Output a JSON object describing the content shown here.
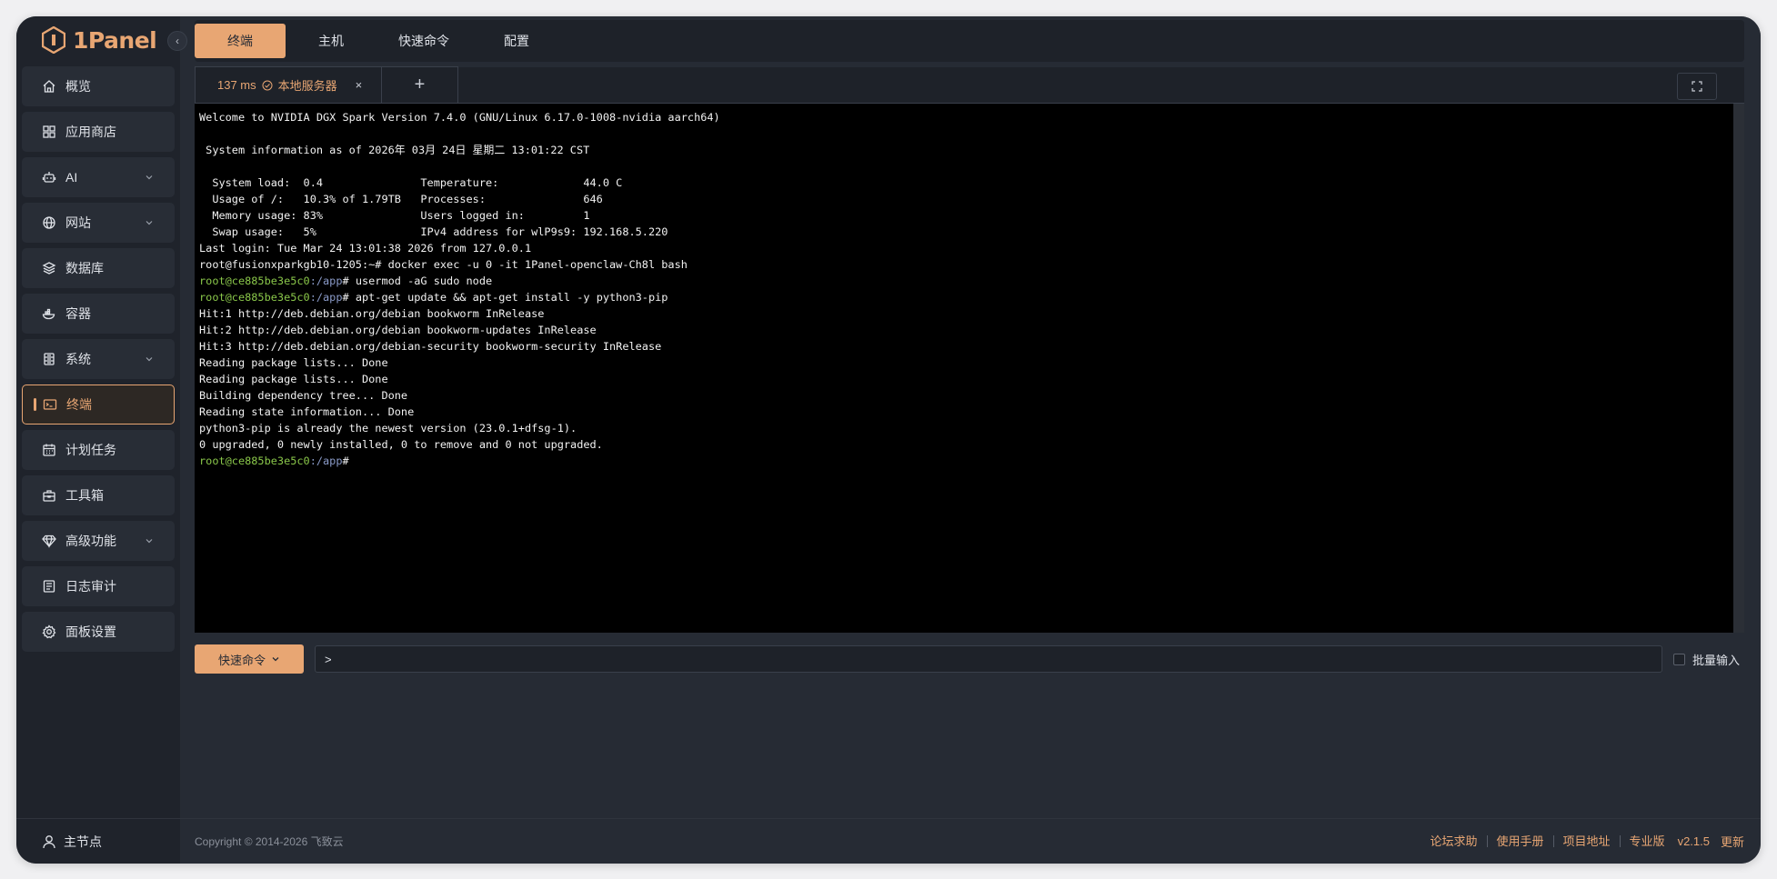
{
  "app": {
    "logo_text": "1Panel"
  },
  "colors": {
    "accent": "#e8a673",
    "background": "#262b34",
    "terminal_bg": "#000000",
    "prompt_green": "#8ac74a"
  },
  "sidebar": {
    "items": [
      {
        "label": "概览",
        "icon": "home-icon"
      },
      {
        "label": "应用商店",
        "icon": "grid-icon"
      },
      {
        "label": "AI",
        "icon": "robot-icon",
        "expandable": true
      },
      {
        "label": "网站",
        "icon": "globe-icon",
        "expandable": true
      },
      {
        "label": "数据库",
        "icon": "layers-icon"
      },
      {
        "label": "容器",
        "icon": "whale-icon"
      },
      {
        "label": "系统",
        "icon": "server-icon",
        "expandable": true
      },
      {
        "label": "终端",
        "icon": "terminal-icon",
        "active": true
      },
      {
        "label": "计划任务",
        "icon": "calendar-icon"
      },
      {
        "label": "工具箱",
        "icon": "toolbox-icon"
      },
      {
        "label": "高级功能",
        "icon": "diamond-icon",
        "expandable": true
      },
      {
        "label": "日志审计",
        "icon": "log-icon"
      },
      {
        "label": "面板设置",
        "icon": "gear-icon"
      }
    ],
    "node_label": "主节点"
  },
  "topbar": {
    "tabs": [
      {
        "label": "终端",
        "active": true
      },
      {
        "label": "主机"
      },
      {
        "label": "快速命令"
      },
      {
        "label": "配置"
      }
    ]
  },
  "terminal_tabs": [
    {
      "latency": "137 ms",
      "name": "本地服务器"
    }
  ],
  "terminal": {
    "lines": [
      {
        "parts": [
          {
            "t": "Welcome to NVIDIA DGX Spark Version 7.4.0 (GNU/Linux 6.17.0-1008-nvidia aarch64)"
          }
        ]
      },
      {
        "parts": [
          {
            "t": ""
          }
        ]
      },
      {
        "parts": [
          {
            "t": " System information as of 2026年 03月 24日 星期二 13:01:22 CST"
          }
        ]
      },
      {
        "parts": [
          {
            "t": ""
          }
        ]
      },
      {
        "parts": [
          {
            "t": "  System load:  0.4               Temperature:             44.0 C"
          }
        ]
      },
      {
        "parts": [
          {
            "t": "  Usage of /:   10.3% of 1.79TB   Processes:               646"
          }
        ]
      },
      {
        "parts": [
          {
            "t": "  Memory usage: 83%               Users logged in:         1"
          }
        ]
      },
      {
        "parts": [
          {
            "t": "  Swap usage:   5%                IPv4 address for wlP9s9: 192.168.5.220"
          }
        ]
      },
      {
        "parts": [
          {
            "t": "Last login: Tue Mar 24 13:01:38 2026 from 127.0.0.1"
          }
        ]
      },
      {
        "parts": [
          {
            "t": "root@fusionxparkgb10-1205:~# docker exec -u 0 -it 1Panel-openclaw-Ch8l bash"
          }
        ]
      },
      {
        "parts": [
          {
            "t": "root@ce885be3e5c0",
            "c": "green"
          },
          {
            "t": ":/app",
            "c": "blue"
          },
          {
            "t": "# usermod -aG sudo node"
          }
        ]
      },
      {
        "parts": [
          {
            "t": "root@ce885be3e5c0",
            "c": "green"
          },
          {
            "t": ":/app",
            "c": "blue"
          },
          {
            "t": "# apt-get update && apt-get install -y python3-pip"
          }
        ]
      },
      {
        "parts": [
          {
            "t": "Hit:1 http://deb.debian.org/debian bookworm InRelease"
          }
        ]
      },
      {
        "parts": [
          {
            "t": "Hit:2 http://deb.debian.org/debian bookworm-updates InRelease"
          }
        ]
      },
      {
        "parts": [
          {
            "t": "Hit:3 http://deb.debian.org/debian-security bookworm-security InRelease"
          }
        ]
      },
      {
        "parts": [
          {
            "t": "Reading package lists... Done"
          }
        ]
      },
      {
        "parts": [
          {
            "t": "Reading package lists... Done"
          }
        ]
      },
      {
        "parts": [
          {
            "t": "Building dependency tree... Done"
          }
        ]
      },
      {
        "parts": [
          {
            "t": "Reading state information... Done"
          }
        ]
      },
      {
        "parts": [
          {
            "t": "python3-pip is already the newest version (23.0.1+dfsg-1)."
          }
        ]
      },
      {
        "parts": [
          {
            "t": "0 upgraded, 0 newly installed, 0 to remove and 0 not upgraded."
          }
        ]
      },
      {
        "parts": [
          {
            "t": "root@ce885be3e5c0",
            "c": "green"
          },
          {
            "t": ":/app",
            "c": "blue"
          },
          {
            "t": "#"
          }
        ]
      }
    ]
  },
  "inputbar": {
    "quick_command_label": "快速命令",
    "input_value": ">",
    "batch_label": "批量输入"
  },
  "footer": {
    "copyright": "Copyright © 2014-2026 飞致云",
    "links": [
      "论坛求助",
      "使用手册",
      "项目地址"
    ],
    "edition": "专业版",
    "version": "v2.1.5",
    "update": "更新"
  }
}
